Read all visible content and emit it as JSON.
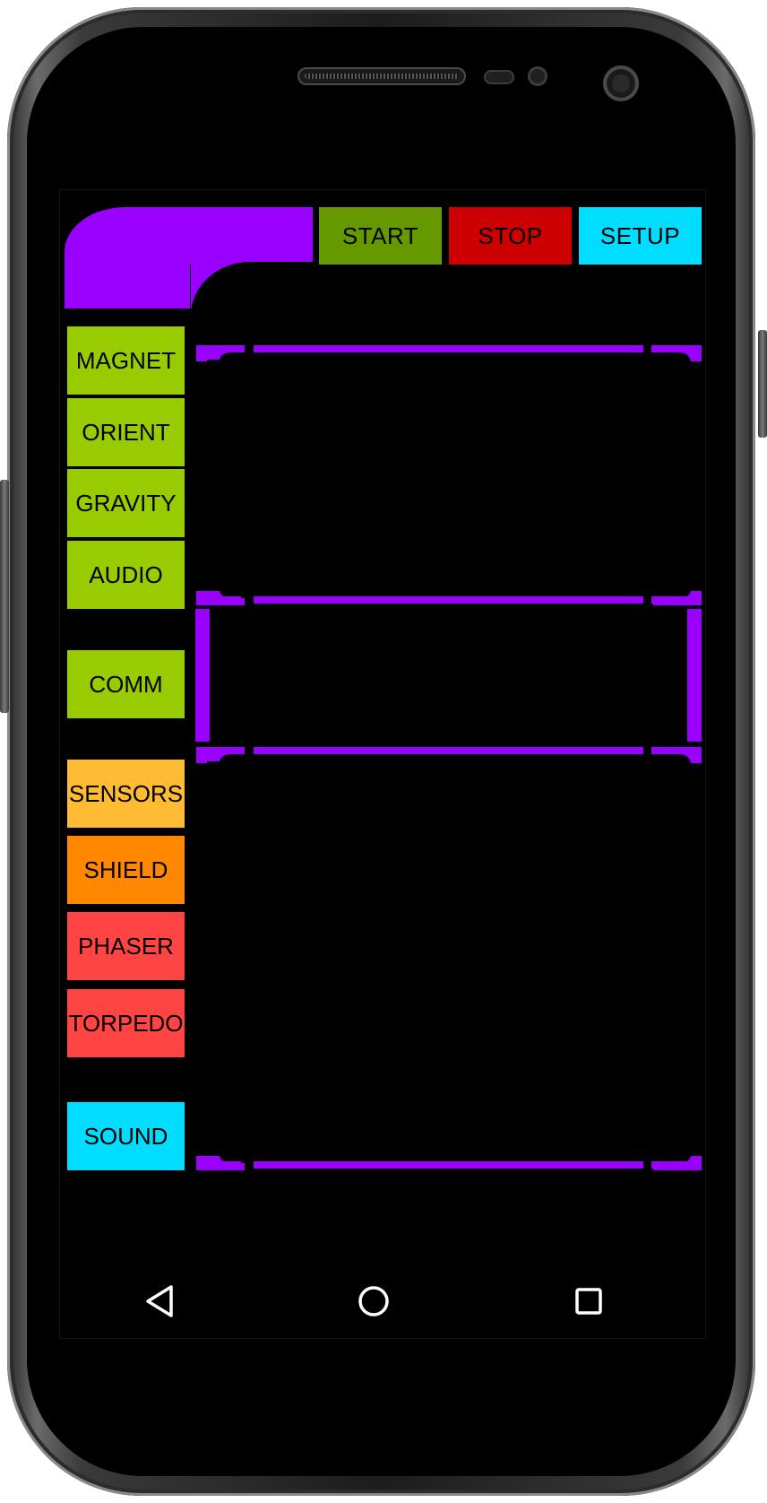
{
  "top_bar": {
    "start_label": "START",
    "stop_label": "STOP",
    "setup_label": "SETUP"
  },
  "sidebar": {
    "items": [
      {
        "label": "MAGNET",
        "color": "#99cc00"
      },
      {
        "label": "ORIENT",
        "color": "#99cc00"
      },
      {
        "label": "GRAVITY",
        "color": "#99cc00"
      },
      {
        "label": "AUDIO",
        "color": "#99cc00"
      },
      {
        "label": "COMM",
        "color": "#99cc00"
      },
      {
        "label": "SENSORS",
        "color": "#ffbb33"
      },
      {
        "label": "SHIELD",
        "color": "#ff8800"
      },
      {
        "label": "PHASER",
        "color": "#ff4444"
      },
      {
        "label": "TORPEDO",
        "color": "#ff4444"
      },
      {
        "label": "SOUND",
        "color": "#00ddff"
      }
    ]
  },
  "colors": {
    "frame": "#9900ff",
    "start": "#669900",
    "stop": "#cc0000",
    "setup": "#00ddff"
  },
  "navbar": {
    "icons": [
      "back-icon",
      "home-icon",
      "recents-icon"
    ]
  }
}
